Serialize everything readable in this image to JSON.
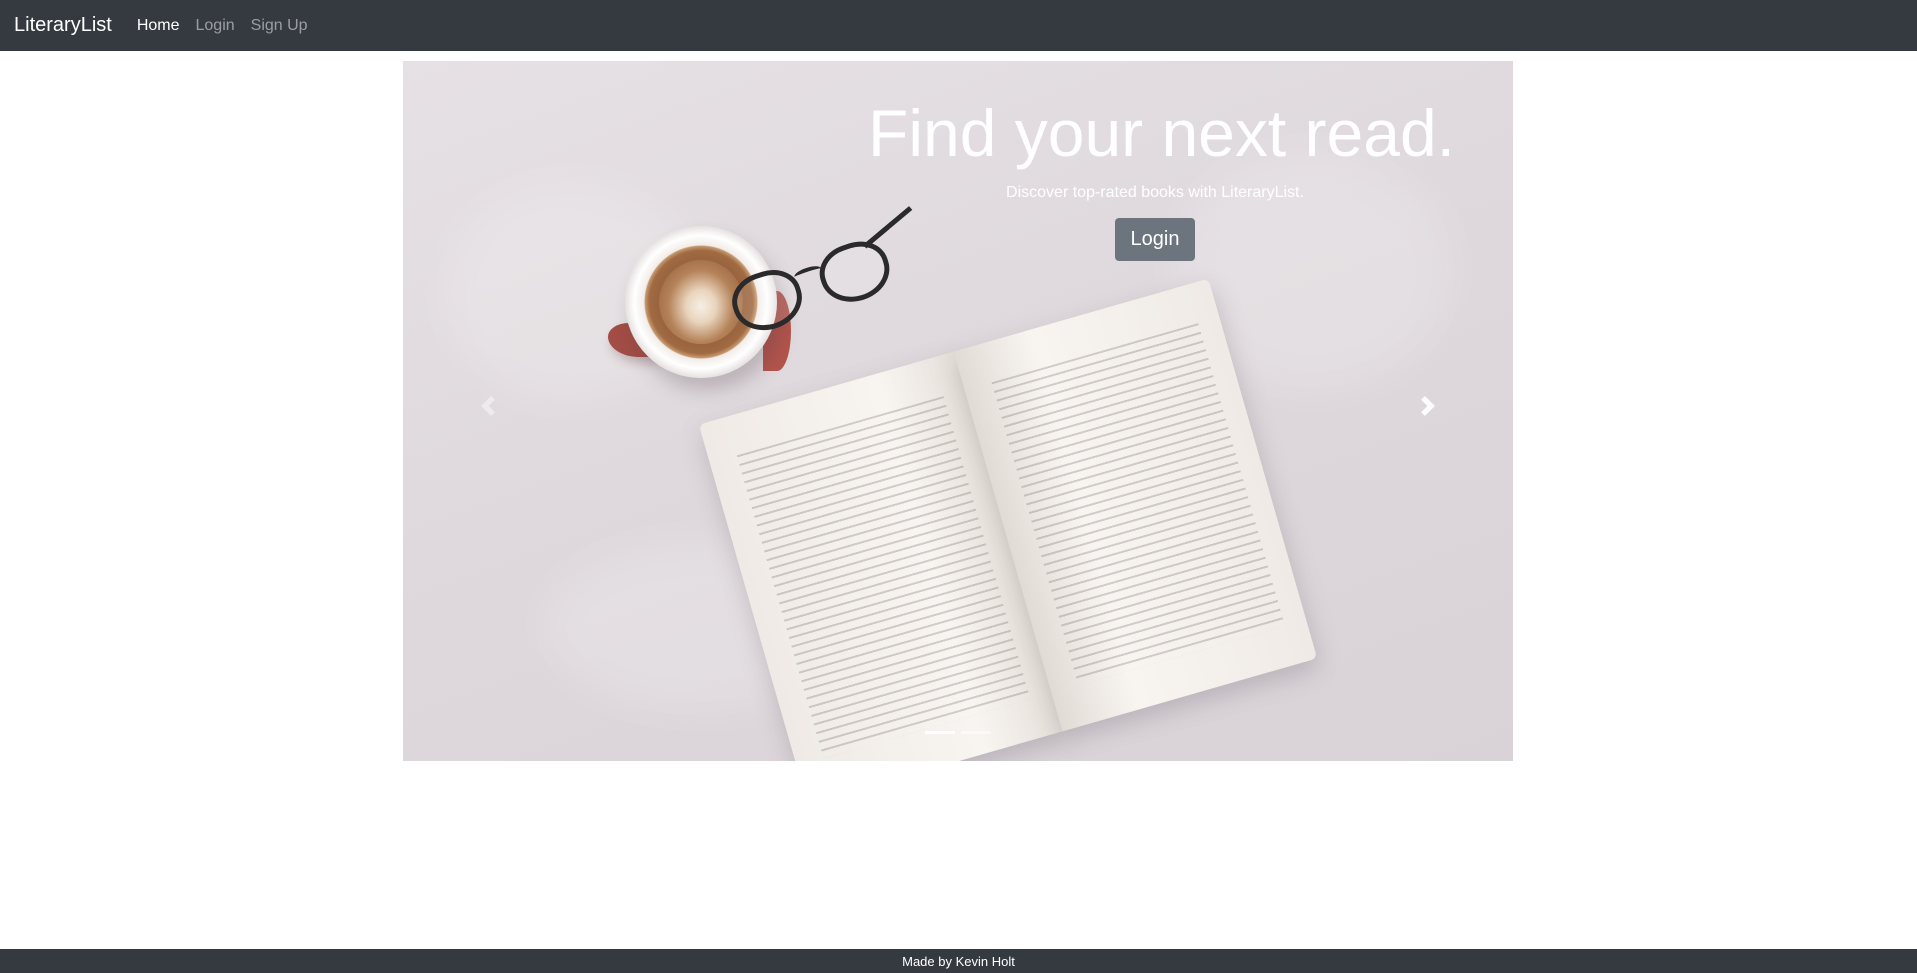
{
  "navbar": {
    "brand": "LiteraryList",
    "links": [
      {
        "label": "Home",
        "active": true
      },
      {
        "label": "Login",
        "active": false
      },
      {
        "label": "Sign Up",
        "active": false
      }
    ]
  },
  "hero": {
    "title": "Find your next read.",
    "subtitle": "Discover top-rated books with LiteraryList.",
    "button_label": "Login",
    "prev_icon": "chevron-left-icon",
    "next_icon": "chevron-right-icon",
    "slide_count": 2,
    "active_slide": 1
  },
  "footer": {
    "text": "Made by Kevin Holt"
  },
  "colors": {
    "navbar_bg": "#343a40",
    "button_bg": "#6c757d",
    "text_light": "#ffffff"
  }
}
